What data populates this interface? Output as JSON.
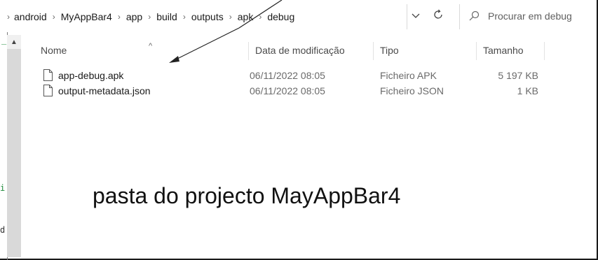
{
  "address_bar": {
    "breadcrumbs": [
      "android",
      "MyAppBar4",
      "app",
      "build",
      "outputs",
      "apk",
      "debug"
    ]
  },
  "search": {
    "placeholder": "Procurar em debug"
  },
  "columns": [
    "Nome",
    "Data de modificação",
    "Tipo",
    "Tamanho"
  ],
  "files": [
    {
      "name": "app-debug.apk",
      "modified": "06/11/2022 08:05",
      "type": "Ficheiro APK",
      "size": "5 197 KB"
    },
    {
      "name": "output-metadata.json",
      "modified": "06/11/2022 08:05",
      "type": "Ficheiro JSON",
      "size": "1 KB"
    }
  ],
  "caption": "pasta do projecto MayAppBar4",
  "side_marks": {
    "mark1": "i",
    "mark2": "d",
    "mark3": "_"
  },
  "colors": {
    "side_marks": "#1e8a3a",
    "annotation": "#222222"
  },
  "icons": [
    "chevron-right-icon",
    "chevron-down-icon",
    "refresh-icon",
    "search-icon",
    "sort-up-icon",
    "file-icon"
  ]
}
